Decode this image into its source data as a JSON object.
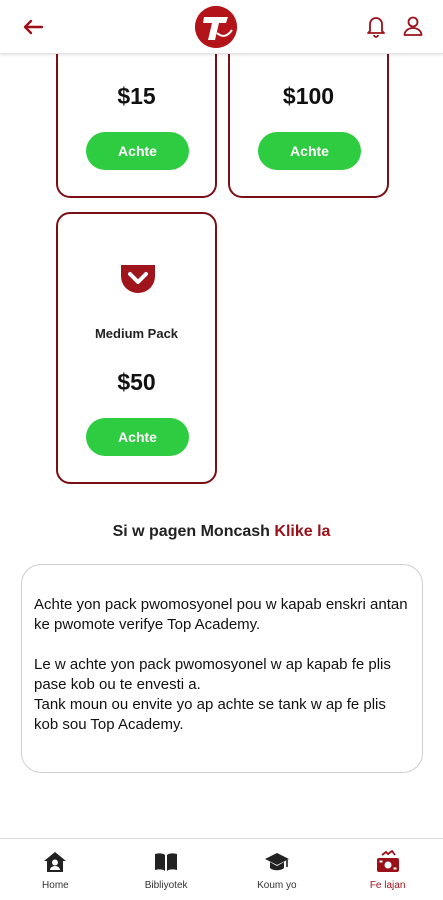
{
  "header": {
    "logo_letter": "T",
    "accent_color": "#b3141a"
  },
  "cards": [
    {
      "price": "$15",
      "button": "Achte"
    },
    {
      "price": "$100",
      "button": "Achte"
    },
    {
      "name": "Medium Pack",
      "price": "$50",
      "button": "Achte",
      "icon": "pocket-icon"
    }
  ],
  "moncash": {
    "text": "Si w pagen Moncash",
    "link": "Klike la"
  },
  "info": {
    "paragraph1": "Achte yon pack pwomosyonel pou w kapab enskri antan ke pwomote verifye Top Academy.",
    "paragraph2": "Le w achte yon pack pwomosyonel w ap kapab fe plis pase kob ou te envesti a.",
    "paragraph3": "Tank moun ou envite yo ap achte se tank w ap fe plis kob sou Top Academy."
  },
  "nav": [
    {
      "label": "Home",
      "icon": "home-icon"
    },
    {
      "label": "Bibliyotek",
      "icon": "book-icon"
    },
    {
      "label": "Koum yo",
      "icon": "graduation-cap-icon"
    },
    {
      "label": "Fe lajan",
      "icon": "money-icon",
      "active": true
    }
  ],
  "colors": {
    "button_green": "#2ecc40",
    "card_border": "#7a1016",
    "link_red": "#9b1119"
  }
}
